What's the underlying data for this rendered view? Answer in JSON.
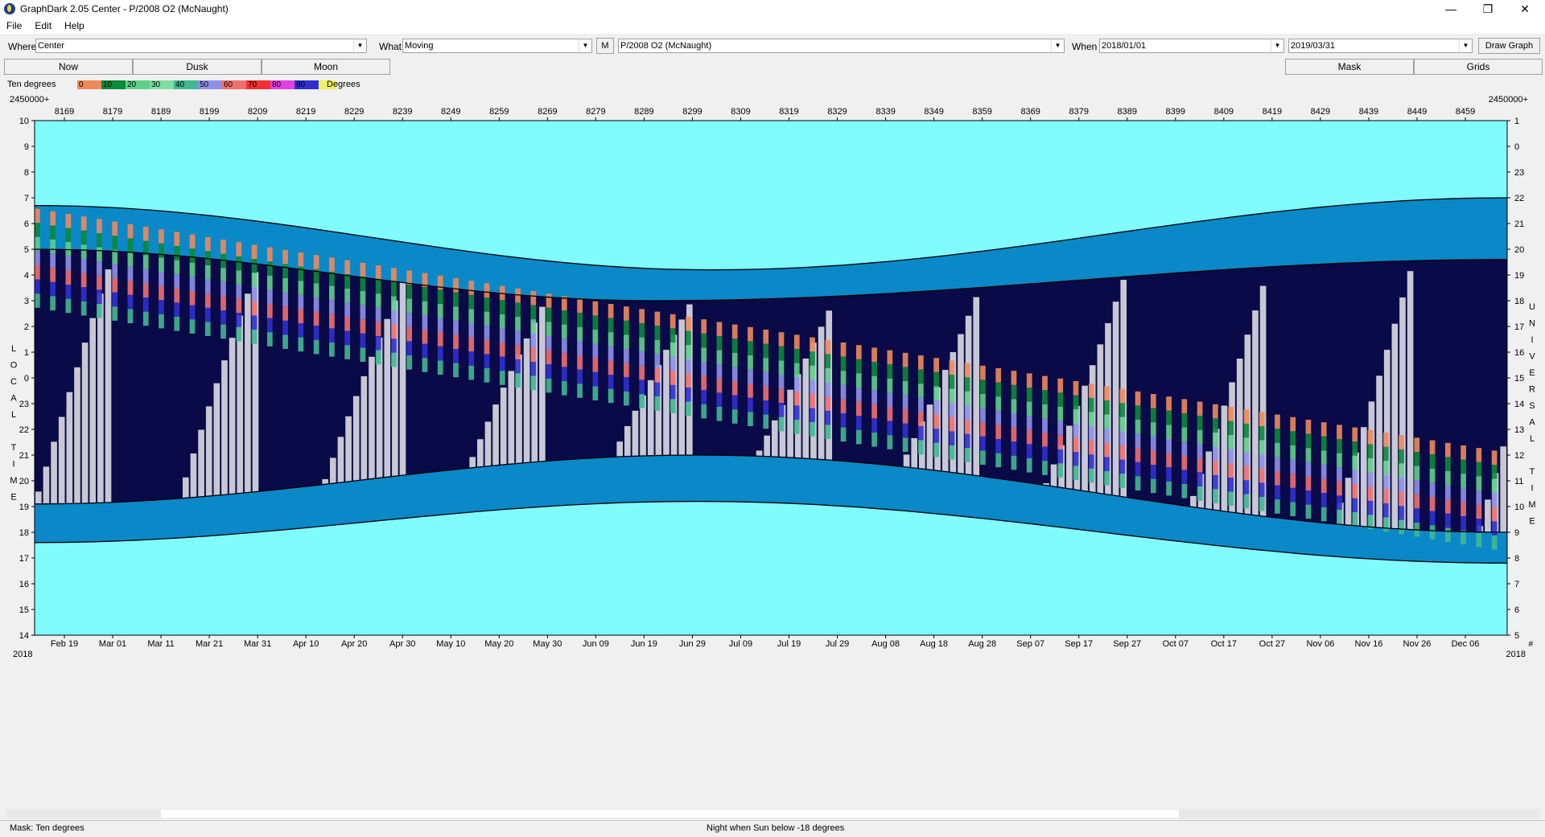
{
  "window": {
    "title": "GraphDark 2.05  Center  -  P/2008 O2 (McNaught)",
    "minimize": "—",
    "maximize": "❐",
    "close": "✕"
  },
  "menu": {
    "items": [
      "File",
      "Edit",
      "Help"
    ]
  },
  "toolbar": {
    "where_label": "Where",
    "where_value": "Center",
    "what_label": "What",
    "what_value": "Moving",
    "m_label": "M",
    "object_value": "P/2008 O2 (McNaught)",
    "when_label": "When",
    "when_start": "2018/01/01",
    "when_end": "2019/03/31",
    "draw_label": "Draw Graph"
  },
  "tabs": {
    "now": "Now",
    "dusk": "Dusk",
    "moon": "Moon",
    "mask": "Mask",
    "grids": "Grids"
  },
  "legend": {
    "label": "Ten degrees",
    "unit_label": "Degrees",
    "swatches": [
      {
        "label": "0",
        "color": "#f08a5a"
      },
      {
        "label": "10",
        "color": "#0a8a3a"
      },
      {
        "label": "20",
        "color": "#5fd08a"
      },
      {
        "label": "30",
        "color": "#7de0a0"
      },
      {
        "label": "40",
        "color": "#40b890"
      },
      {
        "label": "50",
        "color": "#9090e8"
      },
      {
        "label": "60",
        "color": "#f07070"
      },
      {
        "label": "70",
        "color": "#f03030"
      },
      {
        "label": "80",
        "color": "#e040e0"
      },
      {
        "label": "90",
        "color": "#3030d0"
      },
      {
        "label": "",
        "color": "#f0f060"
      }
    ]
  },
  "chart": {
    "top_left_label": "2450000+",
    "top_right_label": "2450000+",
    "left_axis_letters": [
      "L",
      "O",
      "C",
      "A",
      "L",
      "",
      "T",
      "I",
      "M",
      "E"
    ],
    "right_axis_letters": [
      "U",
      "N",
      "I",
      "V",
      "E",
      "R",
      "S",
      "A",
      "L",
      "",
      "T",
      "I",
      "M",
      "E"
    ],
    "bottom_left_year": "2018",
    "bottom_right_year": "2018",
    "bottom_right_corner": "#",
    "colors": {
      "day": "#80fcfc",
      "night": "#0a0a48",
      "twilight": "#0b88c8",
      "moonlight": "#c8c8d4"
    }
  },
  "chart_data": {
    "type": "heatmap",
    "x_top": [
      "8169",
      "8179",
      "8189",
      "8199",
      "8209",
      "8219",
      "8229",
      "8239",
      "8249",
      "8259",
      "8269",
      "8279",
      "8289",
      "8299",
      "8309",
      "8319",
      "8329",
      "8339",
      "8349",
      "8359",
      "8369",
      "8379",
      "8389",
      "8399",
      "8409",
      "8419",
      "8429",
      "8439",
      "8449",
      "8459"
    ],
    "x_bottom": [
      "Feb 19",
      "Mar 01",
      "Mar 11",
      "Mar 21",
      "Mar 31",
      "Apr 10",
      "Apr 20",
      "Apr 30",
      "May 10",
      "May 20",
      "May 30",
      "Jun 09",
      "Jun 19",
      "Jun 29",
      "Jul 09",
      "Jul 19",
      "Jul 29",
      "Aug 08",
      "Aug 18",
      "Aug 28",
      "Sep 07",
      "Sep 17",
      "Sep 27",
      "Oct 07",
      "Oct 17",
      "Oct 27",
      "Nov 06",
      "Nov 16",
      "Nov 26",
      "Dec 06"
    ],
    "y_left": [
      "10",
      "9",
      "8",
      "7",
      "6",
      "5",
      "4",
      "3",
      "2",
      "1",
      "0",
      "23",
      "22",
      "21",
      "20",
      "19",
      "18",
      "17",
      "16",
      "15",
      "14"
    ],
    "y_right": [
      "1",
      "0",
      "23",
      "22",
      "21",
      "20",
      "19",
      "18",
      "17",
      "16",
      "15",
      "14",
      "13",
      "12",
      "11",
      "10",
      "9",
      "8",
      "7",
      "6",
      "5"
    ]
  },
  "status": {
    "left": "Mask:  Ten degrees",
    "center": "Night when Sun below -18 degrees"
  }
}
